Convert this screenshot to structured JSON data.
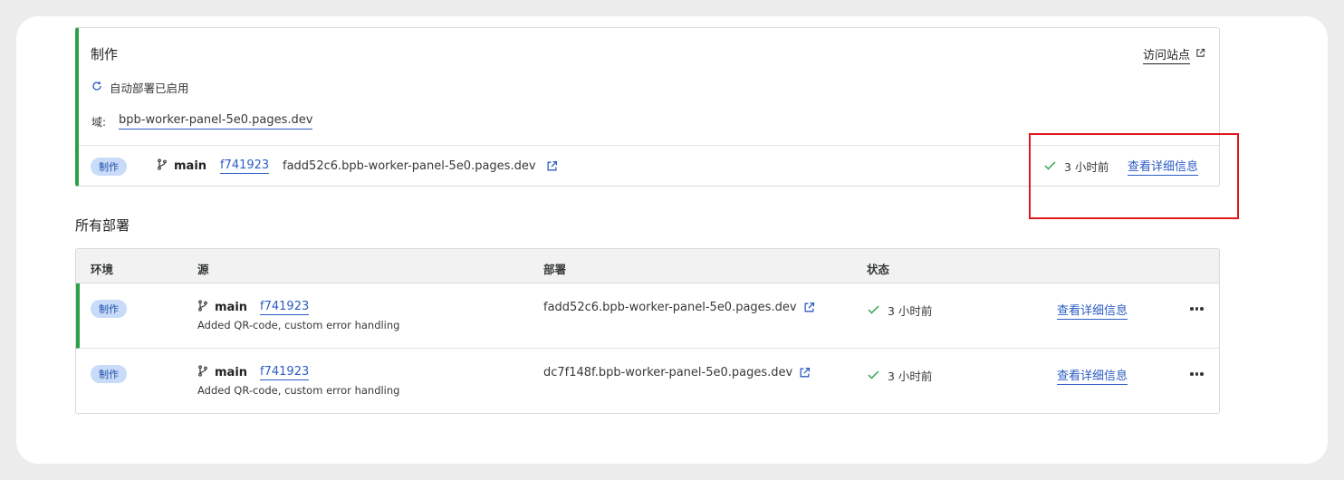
{
  "production": {
    "title": "制作",
    "visit_site": "访问站点",
    "auto_deploy": "自动部署已启用",
    "domain_label": "域:",
    "domain": "bpb-worker-panel-5e0.pages.dev",
    "deployment": {
      "env_badge": "制作",
      "branch": "main",
      "commit": "f741923",
      "url": "fadd52c6.bpb-worker-panel-5e0.pages.dev",
      "status": "3 小时前",
      "details": "查看详细信息"
    }
  },
  "all_deployments": {
    "title": "所有部署",
    "columns": [
      "环境",
      "源",
      "部署",
      "状态"
    ],
    "rows": [
      {
        "env": "制作",
        "branch": "main",
        "commit": "f741923",
        "message": "Added QR-code, custom error handling",
        "url": "fadd52c6.bpb-worker-panel-5e0.pages.dev",
        "status": "3 小时前",
        "details": "查看详细信息"
      },
      {
        "env": "制作",
        "branch": "main",
        "commit": "f741923",
        "message": "Added QR-code, custom error handling",
        "url": "dc7f148f.bpb-worker-panel-5e0.pages.dev",
        "status": "3 小时前",
        "details": "查看详细信息"
      }
    ]
  },
  "colors": {
    "accent": "#2c5cc5",
    "success": "#2aa148",
    "badge_bg": "#c8dbf8",
    "highlight": "#e0191d"
  },
  "icons": [
    "refresh-icon",
    "branch-icon",
    "external-link-icon",
    "check-icon",
    "more-icon"
  ]
}
